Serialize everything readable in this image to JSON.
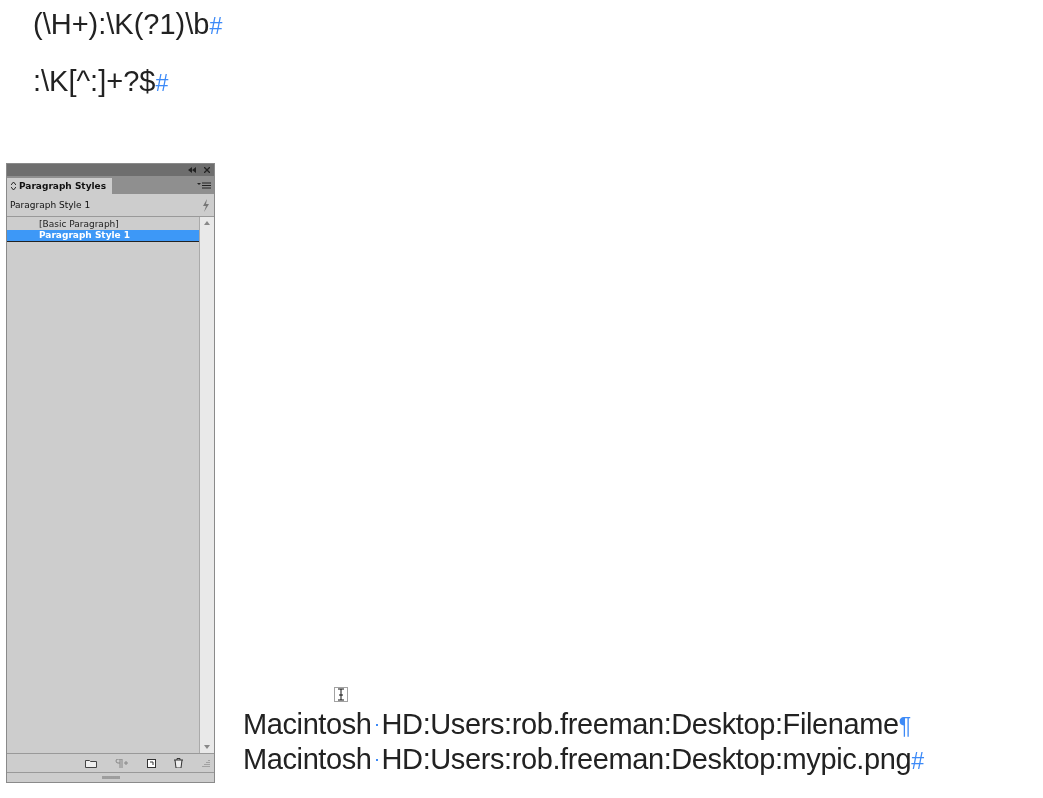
{
  "top_lines": [
    {
      "text": "(\\H+):\\K(?1)\\b",
      "end_mark": "#"
    },
    {
      "text": ":\\K[^:]+?$",
      "end_mark": "#"
    }
  ],
  "panel": {
    "tab": "Paragraph Styles",
    "current_style": "Paragraph Style 1",
    "styles": [
      {
        "label": "[Basic Paragraph]",
        "selected": false
      },
      {
        "label": "Paragraph Style 1",
        "selected": true
      }
    ]
  },
  "document_lines": [
    {
      "segments": [
        "Macintosh",
        "HD:Users:rob.freeman:Desktop:Filename"
      ],
      "end_mark": "¶"
    },
    {
      "segments": [
        "Macintosh",
        "HD:Users:rob.freeman:Desktop:mypic.png"
      ],
      "end_mark": "#"
    }
  ]
}
